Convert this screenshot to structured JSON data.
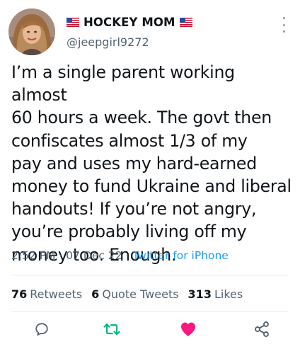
{
  "author": {
    "display_name": "HOCKEY MOM",
    "handle": "@jeepgirl9272",
    "avatar_icon": "avatar-photo",
    "name_decoration_icon": "us-flag-icon"
  },
  "tweet": {
    "text": "I’m a single parent working almost\n60 hours a week. The govt then\nconfiscates almost 1/3 of my\npay and uses my hard-earned\nmoney to fund Ukraine and liberal\nhandouts!  If you’re not angry,\nyou’re probably living off my\nmoney too.  Enough.",
    "time": "2:52 PM",
    "separator": "·",
    "date": "07 Dec 22",
    "source": "Twitter for iPhone"
  },
  "stats": {
    "retweets_count": "76",
    "retweets_label": "Retweets",
    "quote_count": "6",
    "quote_label": "Quote Tweets",
    "likes_count": "313",
    "likes_label": "Likes"
  },
  "actions": {
    "reply_icon": "reply-icon",
    "retweet_icon": "retweet-icon",
    "like_icon": "heart-icon",
    "share_icon": "share-icon"
  },
  "colors": {
    "text": "#0f1419",
    "secondary": "#536471",
    "link": "#1d9bf0",
    "retweet": "#00ba7c",
    "like": "#f91880"
  }
}
